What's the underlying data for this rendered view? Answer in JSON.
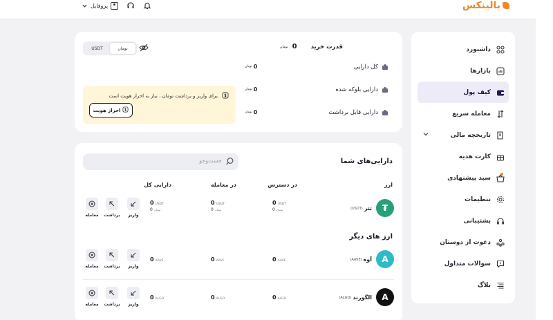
{
  "header": {
    "brand": "بالینکس",
    "profile_label": "پروفایل"
  },
  "sidebar": {
    "items": [
      {
        "label": "داشبورد",
        "icon": "dashboard-grid-icon"
      },
      {
        "label": "بازارها",
        "icon": "chart-icon"
      },
      {
        "label": "کیف پول",
        "icon": "wallet-icon",
        "active": true
      },
      {
        "label": "معامله سریع",
        "icon": "swap-arrows-icon"
      },
      {
        "label": "تاریخچه مالی",
        "icon": "history-doc-icon",
        "expandable": true
      },
      {
        "label": "کارت هدیه",
        "icon": "gift-icon"
      },
      {
        "label": "سبد پیشنهادی",
        "icon": "basket-icon",
        "badge": true
      },
      {
        "label": "تنظیمات",
        "icon": "settings-icon"
      },
      {
        "label": "پشتیبانی",
        "icon": "headset-icon"
      },
      {
        "label": "دعوت از دوستان",
        "icon": "people-icon"
      },
      {
        "label": "سوالات متداول",
        "icon": "faq-icon"
      },
      {
        "label": "بلاگ",
        "icon": "blog-icon"
      }
    ]
  },
  "summary": {
    "currency_toggle": {
      "options": [
        "تومان",
        "USDT"
      ],
      "selected": "تومان"
    },
    "buying_power_label": "قدرت خرید",
    "buying_power_value": "0",
    "currency_unit": "تومان",
    "rows": [
      {
        "label": "کل دارایی",
        "value": "0"
      },
      {
        "label": "دارایی بلوکه شده",
        "value": "0"
      },
      {
        "label": "دارایی قابل برداشت",
        "value": "0"
      }
    ],
    "notice_text": "برای واریز و برداشت تومان ، نیاز به احراز هویت است.",
    "kyc_button": "احراز هویت"
  },
  "assets": {
    "title": "دارایی‌های شما",
    "search_placeholder": "جست‌وجو",
    "columns": [
      "ارز",
      "در دسترس",
      "در معامله",
      "دارایی کل"
    ],
    "other_title": "ارز های دیگر",
    "actions": [
      "واریز",
      "برداشت",
      "معامله"
    ],
    "rows": [
      {
        "name": "تتر",
        "symbol": "(USDT)",
        "color": "#26a17b",
        "glyph": "₮",
        "available": "0",
        "available_sub": "0",
        "in_trade": "0",
        "in_trade_sub": "0",
        "total": "0",
        "total_sub": "0",
        "unit": "USDT",
        "sub_unit": "تومان"
      },
      {
        "name": "آوه",
        "symbol": "(AAVE)",
        "color": "#2ebac6",
        "glyph": "A",
        "available": "0",
        "in_trade": "0",
        "total": "0",
        "unit": "AAVE"
      },
      {
        "name": "الگورند",
        "symbol": "(ALGO)",
        "color": "#111111",
        "glyph": "A",
        "available": "0",
        "in_trade": "0",
        "total": "0",
        "unit": "ALGO"
      }
    ]
  }
}
